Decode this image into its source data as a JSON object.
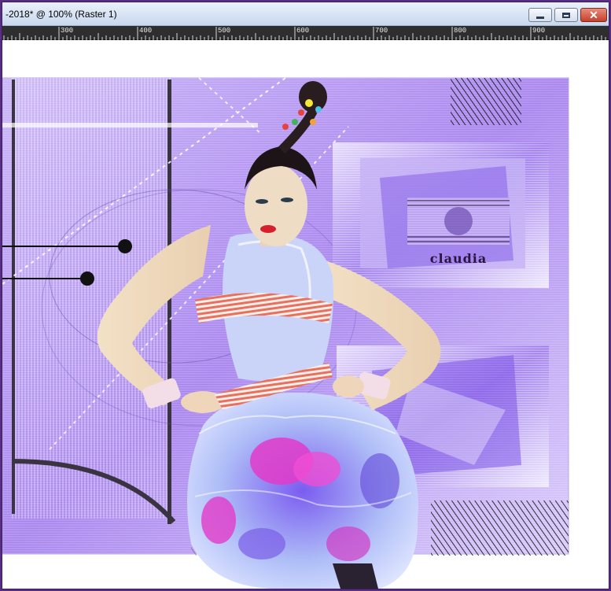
{
  "window": {
    "title": "-2018* @ 100% (Raster 1)",
    "buttons": {
      "minimize": "minimize-icon",
      "maximize": "maximize-icon",
      "close": "close-icon"
    }
  },
  "ruler": {
    "labels": [
      "300",
      "400",
      "500",
      "600",
      "700",
      "800",
      "900"
    ]
  },
  "canvas": {
    "watermark_text": "claudia"
  },
  "colors": {
    "frame": "#5a2d84",
    "lavender": "#b79cf2",
    "violet": "#8a63e6",
    "magenta": "#e23bc9",
    "close_red": "#c5402c"
  }
}
